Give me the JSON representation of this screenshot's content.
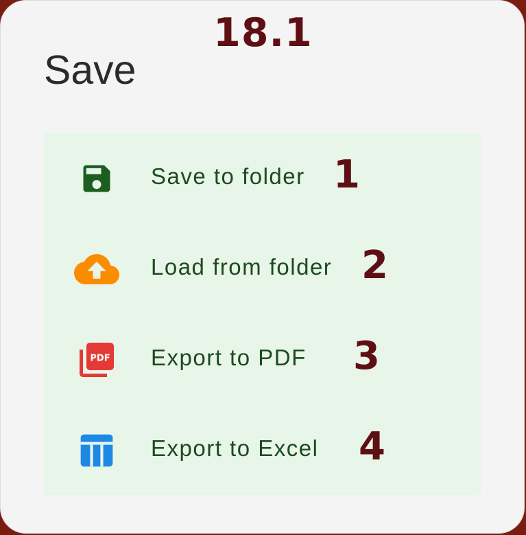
{
  "figure_number": "18.1",
  "dialog": {
    "title": "Save",
    "menu_items": [
      {
        "label": "Save to folder",
        "icon": "save-icon",
        "step": "1",
        "icon_color": "#1b5e20"
      },
      {
        "label": "Load from folder",
        "icon": "cloud-upload-icon",
        "step": "2",
        "icon_color": "#fb8c00"
      },
      {
        "label": "Export to PDF",
        "icon": "pdf-icon",
        "step": "3",
        "icon_color": "#e53935"
      },
      {
        "label": "Export to Excel",
        "icon": "table-icon",
        "step": "4",
        "icon_color": "#1e88e5"
      }
    ]
  },
  "colors": {
    "dialog_background": "#f4f4f4",
    "menu_background": "#e8f5e9",
    "label_text": "#1d4a1f",
    "annotation_text": "#5e0f14"
  }
}
